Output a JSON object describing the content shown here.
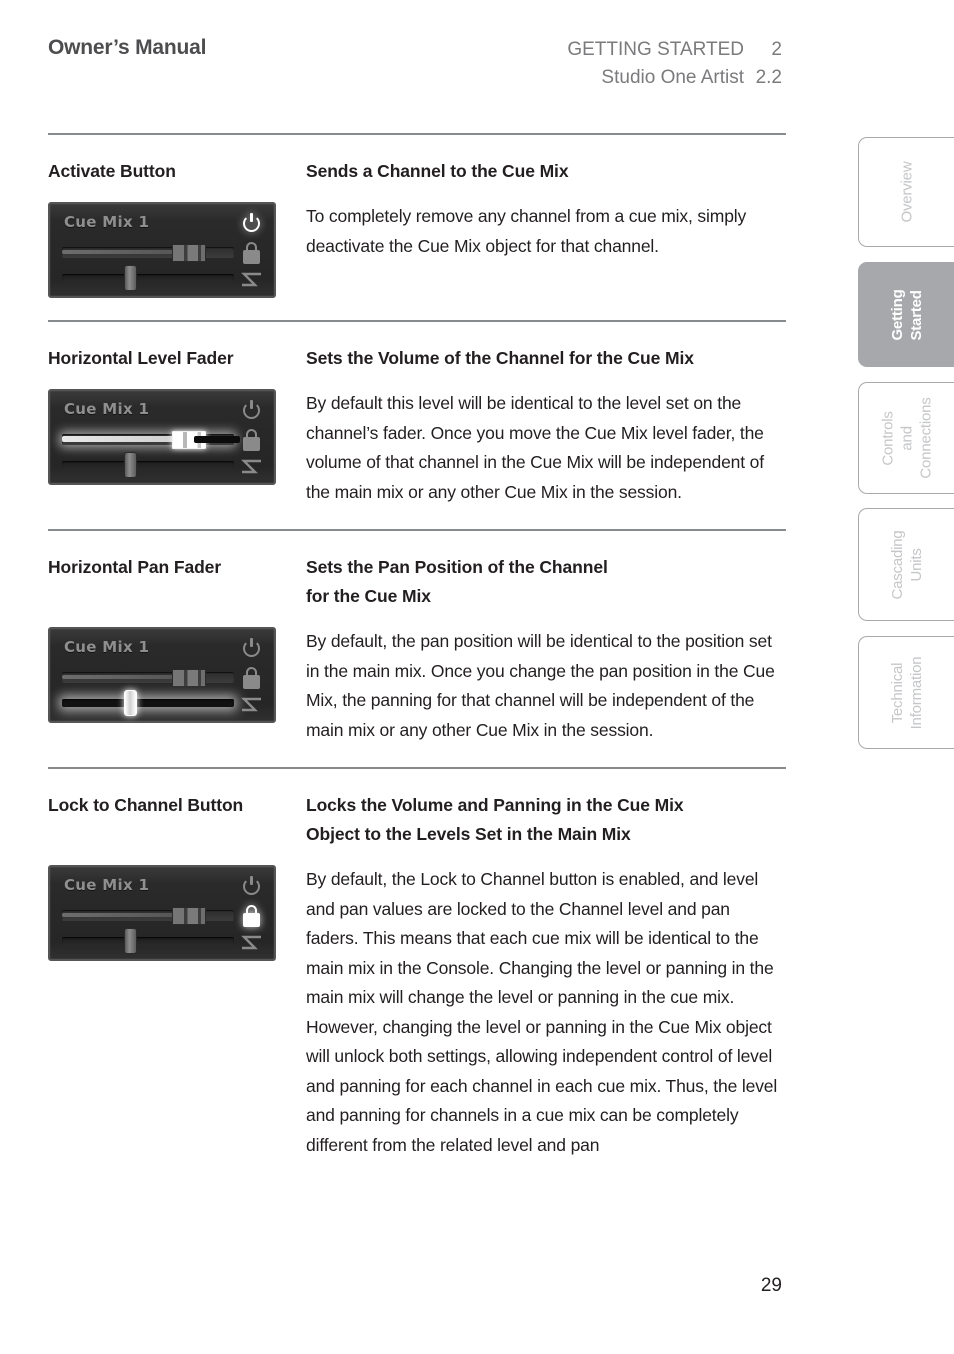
{
  "header": {
    "title": "Owner’s Manual",
    "section_name": "GETTING STARTED",
    "section_number": "2",
    "product_name": "Studio One Artist",
    "product_version": "2.2"
  },
  "sidebar": {
    "tabs": [
      {
        "label": "Overview",
        "active": false
      },
      {
        "label": "Getting\nStarted",
        "active": true
      },
      {
        "label": "Controls and\nConnections",
        "active": false
      },
      {
        "label": "Cascading\nUnits",
        "active": false
      },
      {
        "label": "Technical\nInformation",
        "active": false
      }
    ]
  },
  "sections": [
    {
      "term": "Activate Button",
      "definition": "Sends a Channel to the Cue Mix",
      "body": "To completely remove any channel from a cue mix, simply deactivate the Cue Mix object for that channel.",
      "figure": {
        "label": "Cue Mix 1",
        "highlight": "power"
      }
    },
    {
      "term": "Horizontal Level Fader",
      "definition": "Sets the Volume of the Channel for the Cue Mix",
      "body": "By default this level will be identical to the level set on the channel’s fader. Once you move the Cue Mix level fader, the volume of that channel in the Cue Mix will be independent of the main mix or any other Cue Mix in the session.",
      "figure": {
        "label": "Cue Mix 1",
        "highlight": "level"
      }
    },
    {
      "term": "Horizontal Pan Fader",
      "definition": "Sets the Pan Position of the Channel\nfor the Cue Mix",
      "body": "By default, the pan position will be identical to the position set in the main mix. Once you change the pan position in the Cue Mix, the panning for that channel will be independent of the main mix or any other Cue Mix in the session.",
      "figure": {
        "label": "Cue Mix 1",
        "highlight": "pan"
      }
    },
    {
      "term": "Lock to Channel Button",
      "definition": "Locks the Volume and Panning in the Cue Mix\nObject to the Levels Set in the Main Mix",
      "body": "By default, the Lock to Channel button is enabled, and level and pan values are locked to the Channel level and pan faders. This means that each cue mix will be identical to the main mix in the Console. Changing the level or panning in the main mix will change the level or panning in the cue mix. However, changing the level or panning in the Cue Mix object will unlock both settings, allowing independent control of level and panning for each channel in each cue mix. Thus, the level and panning for channels in a cue mix can be completely different from the related level and pan",
      "figure": {
        "label": "Cue Mix 1",
        "highlight": "lock"
      }
    }
  ],
  "footer": {
    "page_number": "29"
  },
  "colors": {
    "rule": "#888b8d",
    "header_title": "#4d4d4f",
    "header_meta": "#7b7b7e",
    "tab_active_bg": "#a6a8ab",
    "tab_inactive_text": "#c5c6c8",
    "body_text": "#231f20"
  }
}
